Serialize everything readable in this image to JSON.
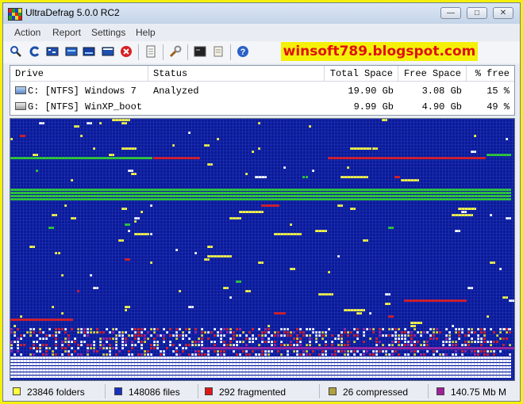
{
  "window": {
    "title": "UltraDefrag 5.0.0 RC2",
    "controls": [
      "minimize",
      "maximize",
      "close"
    ]
  },
  "menu": [
    "Action",
    "Report",
    "Settings",
    "Help"
  ],
  "toolbar": {
    "icons": [
      "analyze-icon",
      "refresh-icon",
      "defragment-icon",
      "quick-optimize-icon",
      "full-optimize-icon",
      "mft-optimize-icon",
      "stop-icon",
      "report-icon",
      "settings-icon",
      "boot-time-icon",
      "script-icon",
      "help-icon"
    ]
  },
  "watermark": "winsoft789.blogspot.com",
  "drivelist": {
    "columns": [
      "Drive",
      "Status",
      "Total Space",
      "Free Space",
      "% free"
    ],
    "rows": [
      {
        "drive": "C: [NTFS]  Windows 7",
        "status": "Analyzed",
        "total": "19.90 Gb",
        "free": "3.08 Gb",
        "pct": "15 %"
      },
      {
        "drive": "G: [NTFS]  WinXP_boot",
        "status": "",
        "total": "9.99 Gb",
        "free": "4.90 Gb",
        "pct": "49 %"
      }
    ]
  },
  "map_colors": {
    "free": "#0a1a9a",
    "grid": "#3c50c8",
    "system": "#2ad02a",
    "fragmented": "#e01818",
    "unfragmented": "#ffffff",
    "compressed": "#d8d230",
    "mft": "#a0209a",
    "directory": "#ffff40"
  },
  "status": {
    "folders": "23846 folders",
    "files": "148086 files",
    "fragmented": "292 fragmented",
    "compressed": "26 compressed",
    "mft": "140.75 Mb M"
  }
}
